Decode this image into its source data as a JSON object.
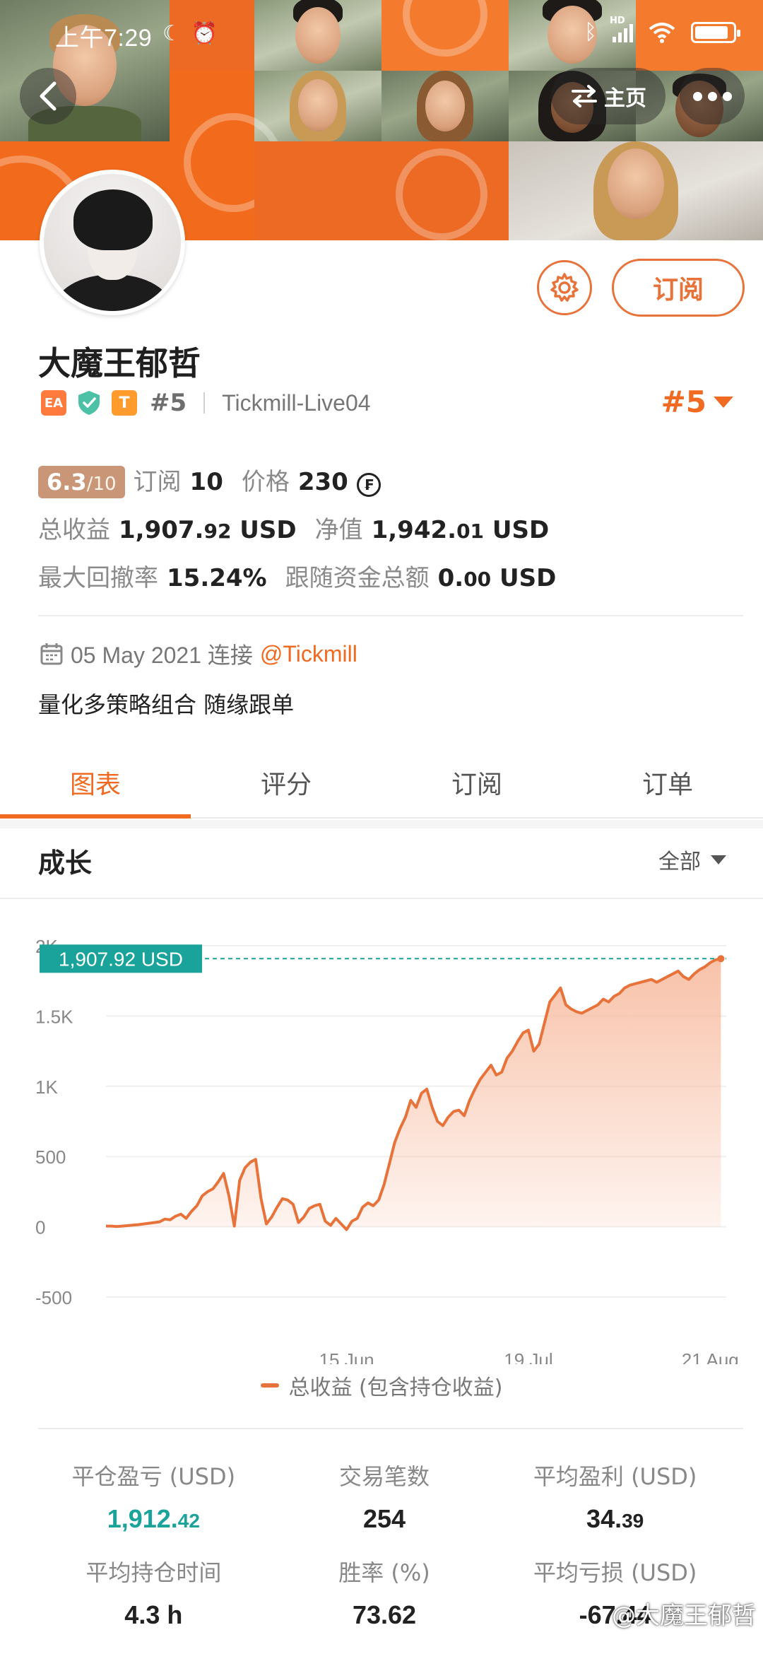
{
  "status_bar": {
    "time": "上午7:29",
    "network_label": "HD"
  },
  "header": {
    "home_label": "主页"
  },
  "profile": {
    "name": "大魔王郁哲",
    "badge_ea": "EA",
    "badge_t": "T",
    "rank_small": "#5",
    "broker": "Tickmill-Live04",
    "rank_big": "#5",
    "subscribe_label": "订阅"
  },
  "stats": {
    "score_value": "6.3",
    "score_denominator": "/10",
    "subscribe_label": "订阅",
    "subscribe_count": "10",
    "price_label": "价格",
    "price_value": "230",
    "coin_symbol": "₣",
    "total_profit_label": "总收益",
    "total_profit_main": "1,907.",
    "total_profit_dec": "92",
    "total_profit_unit": "USD",
    "equity_label": "净值",
    "equity_main": "1,942.",
    "equity_dec": "01",
    "equity_unit": "USD",
    "drawdown_label": "最大回撤率",
    "drawdown_value": "15.24%",
    "follow_label": "跟随资金总额",
    "follow_main": "0.",
    "follow_dec": "00",
    "follow_unit": "USD"
  },
  "connect": {
    "date": "05 May 2021 连接",
    "link": "@Tickmill"
  },
  "description": "量化多策略组合 随缘跟单",
  "tabs": [
    {
      "label": "图表"
    },
    {
      "label": "评分"
    },
    {
      "label": "订阅"
    },
    {
      "label": "订单"
    }
  ],
  "growth": {
    "title": "成长",
    "range_label": "全部"
  },
  "chart_data": {
    "type": "area",
    "title": "",
    "y_ticks": [
      "2K",
      "1.5K",
      "1K",
      "500",
      "0",
      "-500"
    ],
    "y_tick_values": [
      2000,
      1500,
      1000,
      500,
      0,
      -500
    ],
    "ylim": [
      -500,
      2000
    ],
    "x_ticks": [
      "15 Jun",
      "19 Jul",
      "21 Aug"
    ],
    "x_tick_positions": [
      45,
      79,
      113
    ],
    "xlim": [
      0,
      116
    ],
    "series": [
      {
        "name": "总收益 (包含持仓收益)",
        "values": [
          5,
          5,
          2,
          5,
          8,
          12,
          15,
          20,
          25,
          30,
          35,
          55,
          50,
          75,
          90,
          60,
          110,
          150,
          220,
          250,
          270,
          320,
          380,
          220,
          5,
          330,
          420,
          460,
          480,
          200,
          20,
          70,
          140,
          200,
          190,
          160,
          30,
          70,
          130,
          150,
          160,
          40,
          10,
          60,
          20,
          -20,
          40,
          60,
          140,
          170,
          150,
          190,
          300,
          450,
          600,
          700,
          780,
          900,
          850,
          950,
          980,
          850,
          750,
          720,
          780,
          820,
          830,
          790,
          900,
          980,
          1050,
          1100,
          1150,
          1080,
          1100,
          1200,
          1250,
          1320,
          1380,
          1400,
          1250,
          1300,
          1450,
          1600,
          1650,
          1700,
          1580,
          1550,
          1530,
          1520,
          1540,
          1560,
          1580,
          1620,
          1600,
          1640,
          1660,
          1700,
          1720,
          1730,
          1740,
          1750,
          1760,
          1740,
          1760,
          1780,
          1800,
          1820,
          1780,
          1760,
          1800,
          1830,
          1850,
          1880,
          1900,
          1907.92
        ]
      }
    ],
    "current_value_label": "1,907.92 USD",
    "current_value": 1907.92,
    "line_color": "#e8733a",
    "fill_color": "#f7b79a",
    "grid": true,
    "legend": "bottom-center"
  },
  "metrics": [
    {
      "label": "平仓盈亏 (USD)",
      "main": "1,912.",
      "dec": "42",
      "color": "#1aa39a"
    },
    {
      "label": "交易笔数",
      "main": "254",
      "dec": ""
    },
    {
      "label": "平均盈利 (USD)",
      "main": "34.",
      "dec": "39"
    },
    {
      "label": "平均持仓时间",
      "main": "4.3 h",
      "dec": ""
    },
    {
      "label": "胜率 (%)",
      "main": "73.62",
      "dec": ""
    },
    {
      "label": "平均亏损 (USD)",
      "main": "-67.44",
      "dec": ""
    }
  ],
  "watermark": "@大魔王郁哲",
  "colors": {
    "accent": "#f06a22",
    "teal": "#1aa39a",
    "score_badge": "#c99777"
  }
}
